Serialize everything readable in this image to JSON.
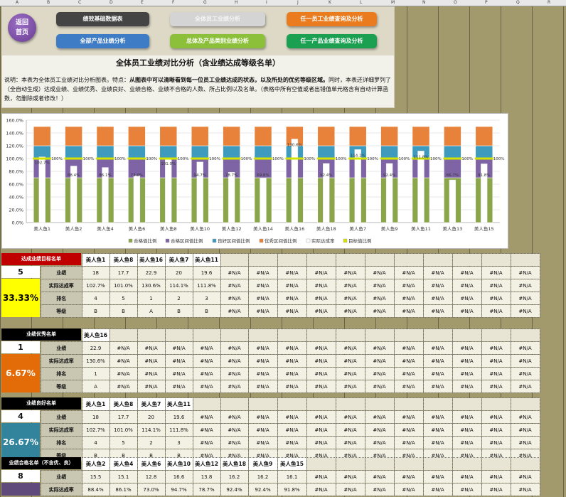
{
  "column_headers": [
    "A",
    "B",
    "C",
    "D",
    "E",
    "F",
    "G",
    "H",
    "I",
    "J",
    "K",
    "L",
    "M",
    "N",
    "O",
    "P",
    "Q",
    "R"
  ],
  "nav": {
    "back": "返回首页",
    "buttons": [
      {
        "label": "绩效基础数据表",
        "color": "#444444"
      },
      {
        "label": "全体员工业绩分析",
        "color": "#cfcfcf"
      },
      {
        "label": "任一员工业绩查询及分析",
        "color": "#ea7c1f"
      },
      {
        "label": "全部产品业绩分析",
        "color": "#3f7cc6"
      },
      {
        "label": "总体及产品类别业绩分析",
        "color": "#8cc03a"
      },
      {
        "label": "任一产品业绩查询及分析",
        "color": "#1aa050"
      }
    ]
  },
  "page_title": "全体员工业绩对比分析（含业绩达成等级名单）",
  "description": {
    "prefix": "说明：本表为全体员工业绩对比分析图表。特点：",
    "bold": "从图表中可以清晰看到每一位员工业绩达成的状态，以及所处的优劣等级区域。",
    "rest": "同时，本表还详细罗列了（全自动生成）达成业绩、业绩优秀、业绩良好、业绩合格、业绩不合格的人数、所占比例以及名单。（表格中所有空值或者出错值单元格含有自动计算函数，勿删除或者修改！）"
  },
  "chart_data": {
    "type": "bar",
    "categories": [
      "美人鱼1",
      "美人鱼2",
      "美人鱼4",
      "美人鱼6",
      "美人鱼8",
      "美人鱼10",
      "美人鱼12",
      "美人鱼14",
      "美人鱼16",
      "美人鱼18",
      "美人鱼7",
      "美人鱼9",
      "美人鱼11",
      "美人鱼13",
      "美人鱼15"
    ],
    "actual_rate_labels": [
      "102.7%",
      "88.4%",
      "86.1%",
      "73.0%",
      "101.0%",
      "94.7%",
      "78.7%",
      "69.6%",
      "130.6%",
      "92.4%",
      "114.1%",
      "92.4%",
      "111.8%",
      "66.7%",
      "91.8%"
    ],
    "actual_rate": [
      102.7,
      88.4,
      86.1,
      73.0,
      101.0,
      94.7,
      78.7,
      69.6,
      130.6,
      92.4,
      114.1,
      92.4,
      111.8,
      66.7,
      91.8
    ],
    "target_label": "100%",
    "target": 100,
    "bands": [
      {
        "name": "合格值比例",
        "from": 0,
        "to": 70,
        "color": "#8aa54a"
      },
      {
        "name": "合格区间值比例",
        "from": 70,
        "to": 100,
        "color": "#7e64a5"
      },
      {
        "name": "良好区间值比例",
        "from": 100,
        "to": 120,
        "color": "#3e9bbd"
      },
      {
        "name": "优秀区间值比例",
        "from": 120,
        "to": 150,
        "color": "#e8823a"
      }
    ],
    "series_names": [
      "合格值比例",
      "合格区间值比例",
      "良好区间值比例",
      "优秀区间值比例",
      "实际达成率",
      "目标值比例"
    ],
    "yticks": [
      "0.0%",
      "20.0%",
      "40.0%",
      "60.0%",
      "80.0%",
      "100.0%",
      "120.0%",
      "140.0%",
      "160.0%"
    ],
    "ylim": [
      0,
      160
    ],
    "legend_position": "bottom"
  },
  "sections": [
    {
      "header": "达成业绩目标名单",
      "header_color": "#c00000",
      "count": "5",
      "pct": "33.33%",
      "pct_bg": "#ffff00",
      "pct_color": "#000000",
      "names": [
        "美人鱼1",
        "美人鱼8",
        "美人鱼16",
        "美人鱼7",
        "美人鱼11"
      ],
      "rows": [
        {
          "label": "业绩",
          "values": [
            "18",
            "17.7",
            "22.9",
            "20",
            "19.6"
          ]
        },
        {
          "label": "实际达成率",
          "values": [
            "102.7%",
            "101.0%",
            "130.6%",
            "114.1%",
            "111.8%"
          ]
        },
        {
          "label": "排名",
          "values": [
            "4",
            "5",
            "1",
            "2",
            "3"
          ]
        },
        {
          "label": "等级",
          "values": [
            "B",
            "B",
            "A",
            "B",
            "B"
          ]
        }
      ]
    },
    {
      "header": "业绩优秀名单",
      "header_color": "#000000",
      "count": "1",
      "pct": "6.67%",
      "pct_bg": "#e36c09",
      "pct_color": "#ffffff",
      "names": [
        "美人鱼16"
      ],
      "rows": [
        {
          "label": "业绩",
          "values": [
            "22.9"
          ]
        },
        {
          "label": "实际达成率",
          "values": [
            "130.6%"
          ]
        },
        {
          "label": "排名",
          "values": [
            "1"
          ]
        },
        {
          "label": "等级",
          "values": [
            "A"
          ]
        }
      ]
    },
    {
      "header": "业绩良好名单",
      "header_color": "#000000",
      "count": "4",
      "pct": "26.67%",
      "pct_bg": "#31849b",
      "pct_color": "#ffffff",
      "names": [
        "美人鱼1",
        "美人鱼8",
        "美人鱼7",
        "美人鱼11"
      ],
      "rows": [
        {
          "label": "业绩",
          "values": [
            "18",
            "17.7",
            "20",
            "19.6"
          ]
        },
        {
          "label": "实际达成率",
          "values": [
            "102.7%",
            "101.0%",
            "114.1%",
            "111.8%"
          ]
        },
        {
          "label": "排名",
          "values": [
            "4",
            "5",
            "2",
            "3"
          ]
        },
        {
          "label": "等级",
          "values": [
            "B",
            "B",
            "B",
            "B"
          ]
        }
      ]
    },
    {
      "header": "业绩合格名单（不含优、良）",
      "header_color": "#000000",
      "count": "8",
      "pct": "",
      "pct_bg": "#604a7b",
      "pct_color": "#ffffff",
      "names": [
        "美人鱼2",
        "美人鱼4",
        "美人鱼6",
        "美人鱼10",
        "美人鱼12",
        "美人鱼18",
        "美人鱼9",
        "美人鱼15"
      ],
      "rows": [
        {
          "label": "业绩",
          "values": [
            "15.5",
            "15.1",
            "12.8",
            "16.6",
            "13.8",
            "16.2",
            "16.2",
            "16.1"
          ]
        },
        {
          "label": "实际达成率",
          "values": [
            "88.4%",
            "86.1%",
            "73.0%",
            "94.7%",
            "78.7%",
            "92.4%",
            "92.4%",
            "91.8%"
          ]
        }
      ]
    }
  ],
  "na": "#N/A"
}
